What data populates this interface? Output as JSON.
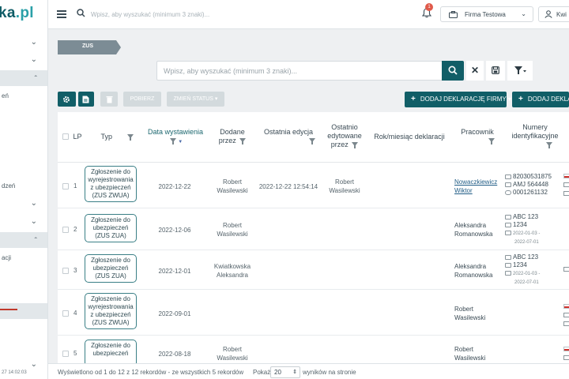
{
  "sidebar": {
    "logo_text": "ka",
    "logo_suffix": ".pl",
    "sub_items": [
      "eń",
      "dzeń",
      "acji"
    ],
    "footer_date": "27 14:02:03"
  },
  "topbar": {
    "search_placeholder": "Wpisz, aby wyszukać (minimum 3 znaki)...",
    "notification_count": "1",
    "company_label": "Firma Testowa",
    "user_label": "Kwi"
  },
  "breadcrumb": {
    "label": "ZUS"
  },
  "table_search": {
    "placeholder": "Wpisz, aby wyszukać (minimum 3 znaki)..."
  },
  "toolbar": {
    "pobierz_label": "POBIERZ",
    "zmien_status_label": "ZMIEŃ STATUS",
    "add_company_declaration_label": "DODAJ DEKLARACJĘ FIRMY",
    "add_declaration_label": "DODAJ DEKLA"
  },
  "table": {
    "headers": {
      "lp": "LP",
      "typ": "Typ",
      "data_wystawienia": "Data wystawienia",
      "dodane_przez_1": "Dodane",
      "dodane_przez_2": "przez",
      "ostatnia_edycja": "Ostatnia edycja",
      "ostatnio_1": "Ostatnio",
      "ostatnio_2": "edytowane",
      "ostatnio_3": "przez",
      "rok_miesiac": "Rok/miesiąc deklaracji",
      "pracownik": "Pracownik",
      "numery_1": "Numery",
      "numery_2": "identyfikacyjne"
    },
    "rows": [
      {
        "lp": "1",
        "typ": [
          "Zgłoszenie do",
          "wyrejestrowania",
          "z ubezpieczeń",
          "(ZUS ZWUA)"
        ],
        "data": "2022-12-22",
        "dodane": [
          "Robert",
          "Wasilewski"
        ],
        "edycja": "2022-12-22 12:54:14",
        "edytowane": [
          "Robert",
          "Wasilewski"
        ],
        "pracownik": [
          "Nowaczkiewicz",
          "Wiktor"
        ],
        "ids": [
          "82030531875",
          "AMJ 564448",
          "0001261132"
        ]
      },
      {
        "lp": "2",
        "typ": [
          "Zgłoszenie do",
          "ubezpieczeń",
          "(ZUS ZUA)"
        ],
        "data": "2022-12-06",
        "dodane": [
          "Robert",
          "Wasilewski"
        ],
        "pracownik": [
          "Aleksandra",
          "Romanowska"
        ],
        "ids": [
          "ABC 123",
          "1234",
          "2022-01-03 -",
          "2022-07-01"
        ]
      },
      {
        "lp": "3",
        "typ": [
          "Zgłoszenie do",
          "ubezpieczeń",
          "(ZUS ZUA)"
        ],
        "data": "2022-12-01",
        "dodane": [
          "Kwiatkowska",
          "Aleksandra"
        ],
        "pracownik": [
          "Aleksandra",
          "Romanowska"
        ],
        "ids": [
          "ABC 123",
          "1234",
          "2022-01-03 -",
          "2022-07-01"
        ]
      },
      {
        "lp": "4",
        "typ": [
          "Zgłoszenie do",
          "wyrejestrowania",
          "z ubezpieczeń",
          "(ZUS ZWUA)"
        ],
        "data": "2022-09-01",
        "pracownik": [
          "Robert",
          "Wasilewski"
        ]
      },
      {
        "lp": "5",
        "typ": [
          "Zgłoszenie do",
          "ubezpieczeń"
        ],
        "data": "2022-08-18",
        "dodane": [
          "Robert",
          "Wasilewski"
        ],
        "pracownik": [
          "Robert",
          "Wasilewski"
        ]
      }
    ]
  },
  "footer": {
    "summary": "Wyświetlono od 1 do 12 z 12 rekordów - ze wszystkich 5 rekordów",
    "show_label": "Pokaż",
    "page_size": "20",
    "per_page_label": "wyników na stronie"
  },
  "colors": {
    "primary": "#115e67",
    "accent_red": "#e05a4a"
  }
}
